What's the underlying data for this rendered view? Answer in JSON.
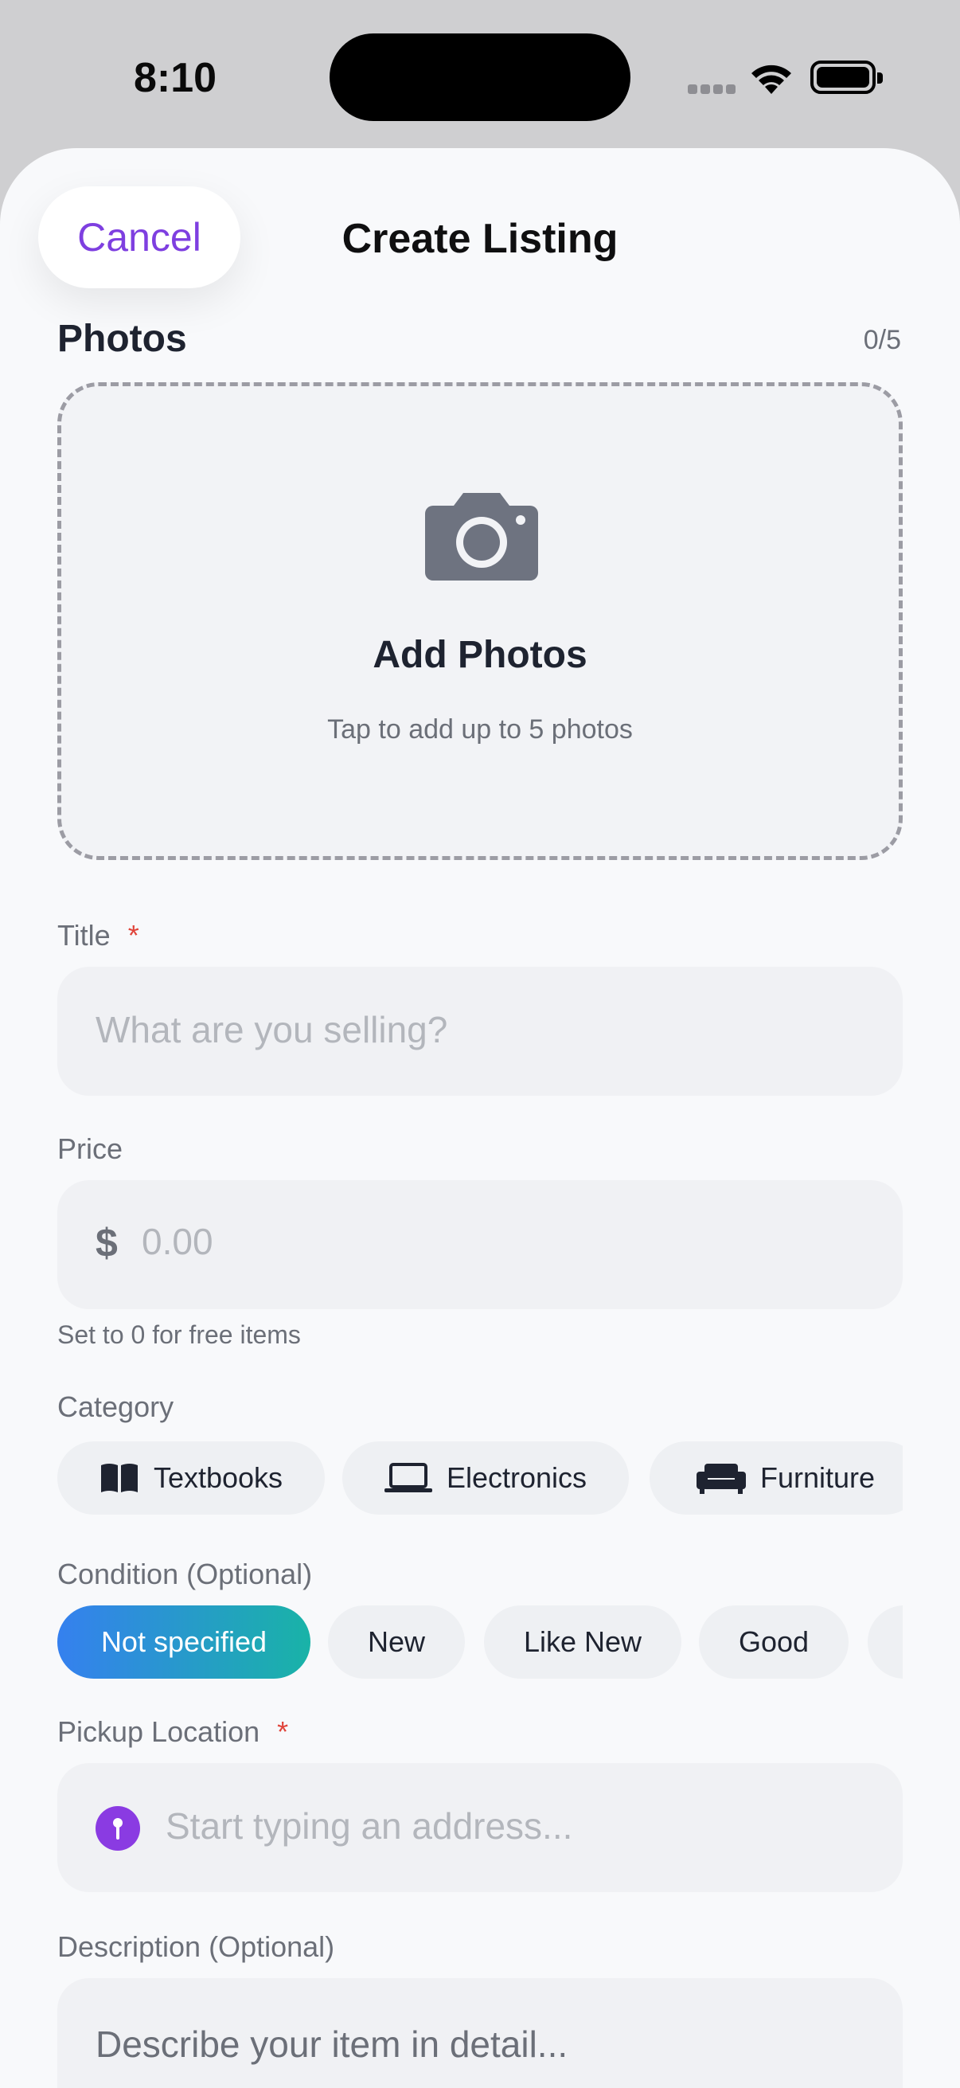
{
  "status": {
    "time": "8:10"
  },
  "header": {
    "cancel_label": "Cancel",
    "title": "Create Listing"
  },
  "photos": {
    "title": "Photos",
    "count": "0/5",
    "add_label": "Add Photos",
    "add_hint": "Tap to add up to 5 photos"
  },
  "title_field": {
    "label": "Title",
    "required_mark": "*",
    "placeholder": "What are you selling?"
  },
  "price_field": {
    "label": "Price",
    "currency": "$",
    "placeholder": "0.00",
    "hint": "Set to 0 for free items"
  },
  "category": {
    "label": "Category",
    "options": [
      {
        "label": "Textbooks",
        "icon": "book-icon"
      },
      {
        "label": "Electronics",
        "icon": "laptop-icon"
      },
      {
        "label": "Furniture",
        "icon": "sofa-icon"
      }
    ]
  },
  "condition": {
    "label": "Condition (Optional)",
    "options": [
      "Not specified",
      "New",
      "Like New",
      "Good"
    ],
    "selected": "Not specified"
  },
  "pickup": {
    "label": "Pickup Location",
    "required_mark": "*",
    "placeholder": "Start typing an address..."
  },
  "description": {
    "label": "Description (Optional)",
    "placeholder": "Describe your item in detail..."
  },
  "colors": {
    "accent": "#7e3fe0",
    "required": "#e0443a",
    "chip_gradient_start": "#3580ef",
    "chip_gradient_end": "#19b3a7",
    "pin": "#8a3be2"
  }
}
